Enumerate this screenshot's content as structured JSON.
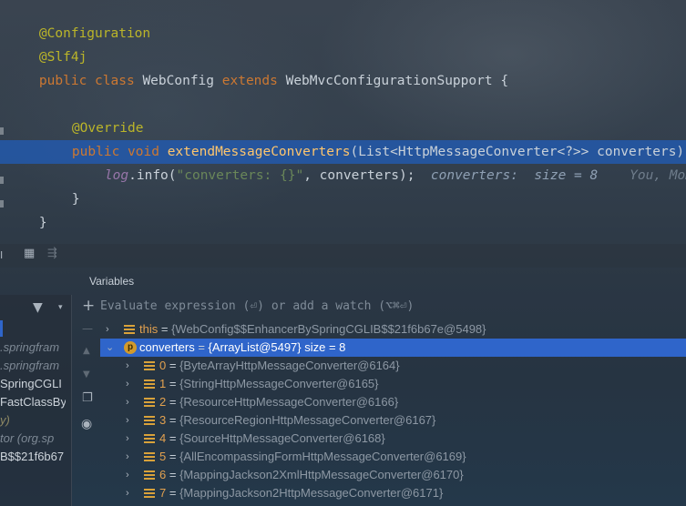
{
  "code": {
    "lines": [
      {
        "annotation": "@Configuration"
      },
      {
        "annotation": "@Slf4j"
      },
      {
        "kw1": "public",
        "kw2": "class",
        "name": "WebConfig",
        "kw3": "extends",
        "parent": "WebMvcConfigurationSupport",
        "tail": "{"
      },
      {},
      {
        "annotation": "@Override"
      },
      {
        "kw1": "public",
        "kw2": "void",
        "method": "extendMessageConverters",
        "params": "(List<HttpMessageConverter<?>> converters) {"
      },
      {
        "logvar": "log",
        "call": ".info(",
        "str": "\"converters: {}\"",
        "args": ", converters);",
        "hint": "converters:  size = 8",
        "author": "You, Mom"
      },
      {
        "brace": "}"
      },
      {
        "brace": "}"
      }
    ]
  },
  "debugger": {
    "variables_title": "Variables",
    "evaluate_placeholder": "Evaluate expression (⏎) or add a watch (⌥⌘⏎)",
    "frames": [
      {
        "text": "",
        "style": "sel"
      },
      {
        "text": ".springfram",
        "style": "dim"
      },
      {
        "text": ".springfram",
        "style": "dim"
      },
      {
        "text": "SpringCGLI",
        "style": "norm"
      },
      {
        "text": "FastClassBy",
        "style": "norm"
      },
      {
        "text": "y)",
        "style": "yellowish"
      },
      {
        "text": "tor (org.sp",
        "style": "dim"
      },
      {
        "text": "B$$21f6b67",
        "style": "norm"
      },
      {
        "text": "",
        "style": "dim"
      }
    ],
    "variables": [
      {
        "name": "this",
        "eq": " = ",
        "value": "{WebConfig$$EnhancerBySpringCGLIB$$21f6b67e@5498}",
        "icon": "field",
        "expanded": false,
        "indent": 0,
        "selected": false
      },
      {
        "name": "converters",
        "eq": " = ",
        "value": "{ArrayList@5497}  size = 8",
        "icon": "param",
        "expanded": true,
        "indent": 0,
        "selected": true
      },
      {
        "name": "0",
        "eq": " = ",
        "value": "{ByteArrayHttpMessageConverter@6164}",
        "icon": "field",
        "expanded": false,
        "indent": 1,
        "selected": false
      },
      {
        "name": "1",
        "eq": " = ",
        "value": "{StringHttpMessageConverter@6165}",
        "icon": "field",
        "expanded": false,
        "indent": 1,
        "selected": false
      },
      {
        "name": "2",
        "eq": " = ",
        "value": "{ResourceHttpMessageConverter@6166}",
        "icon": "field",
        "expanded": false,
        "indent": 1,
        "selected": false
      },
      {
        "name": "3",
        "eq": " = ",
        "value": "{ResourceRegionHttpMessageConverter@6167}",
        "icon": "field",
        "expanded": false,
        "indent": 1,
        "selected": false
      },
      {
        "name": "4",
        "eq": " = ",
        "value": "{SourceHttpMessageConverter@6168}",
        "icon": "field",
        "expanded": false,
        "indent": 1,
        "selected": false
      },
      {
        "name": "5",
        "eq": " = ",
        "value": "{AllEncompassingFormHttpMessageConverter@6169}",
        "icon": "field",
        "expanded": false,
        "indent": 1,
        "selected": false
      },
      {
        "name": "6",
        "eq": " = ",
        "value": "{MappingJackson2XmlHttpMessageConverter@6170}",
        "icon": "field",
        "expanded": false,
        "indent": 1,
        "selected": false
      },
      {
        "name": "7",
        "eq": " = ",
        "value": "{MappingJackson2HttpMessageConverter@6171}",
        "icon": "field",
        "expanded": false,
        "indent": 1,
        "selected": false
      }
    ]
  }
}
